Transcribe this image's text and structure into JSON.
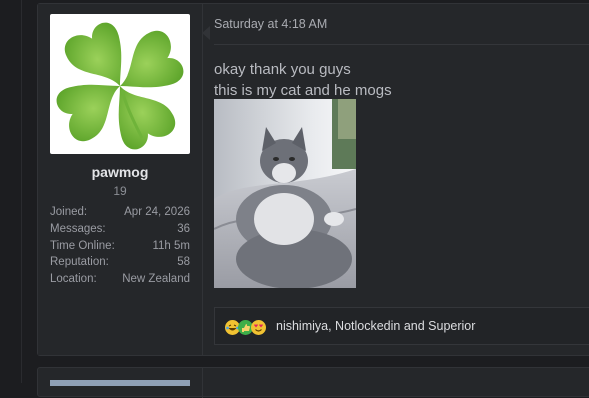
{
  "post": {
    "user": {
      "name": "pawmog",
      "title": "19",
      "stats": [
        {
          "label": "Joined:",
          "value": "Apr 24, 2026"
        },
        {
          "label": "Messages:",
          "value": "36"
        },
        {
          "label": "Time Online:",
          "value": "11h 5m"
        },
        {
          "label": "Reputation:",
          "value": "58"
        },
        {
          "label": "Location:",
          "value": "New Zealand"
        }
      ],
      "avatar_icon": "four-leaf-clover"
    },
    "date": "Saturday at 4:18 AM",
    "lines": [
      "okay thank you guys",
      "this is my cat and he mogs"
    ],
    "image_subject": "grey fluffy cat on bed",
    "reactions": {
      "icons": [
        "laughing-emoji",
        "thumbs-up-emoji",
        "heart-eyes-emoji"
      ],
      "text": "nishimiya, Notlockedin and Superior"
    }
  },
  "colors": {
    "background": "#1c1d20",
    "panel": "#25272a",
    "border": "#313337",
    "text": "#b9bbc1"
  }
}
